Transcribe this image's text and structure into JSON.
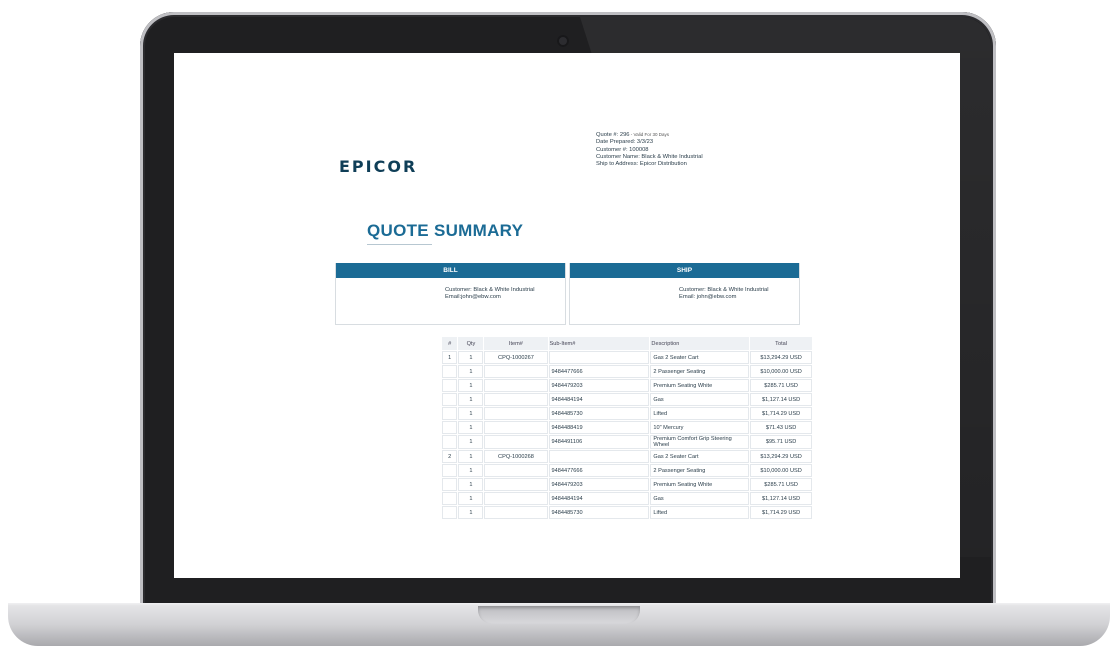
{
  "brand": {
    "logo_text": "EPICOR"
  },
  "meta": {
    "quote_label": "Quote #: 296",
    "valid_note": " - Valid For 30 Days",
    "date_prepared": "Date Prepared: 3/3/23",
    "customer_number": "Customer #: 100008",
    "customer_name": "Customer Name: Black & White Industrial",
    "ship_to": "Ship to Address: Epicor Distribution"
  },
  "title": "QUOTE SUMMARY",
  "bill": {
    "header": "BILL",
    "customer": "Customer: Black & White Industrial",
    "email": "Email:john@ebw.com"
  },
  "ship": {
    "header": "SHIP",
    "customer": "Customer: Black & White Industrial",
    "email": "Email: john@ebw.com"
  },
  "table": {
    "headers": [
      "#",
      "Qty",
      "Item#",
      "Sub-Item#",
      "Description",
      "Total"
    ],
    "rows": [
      [
        "1",
        "1",
        "CPQ-1000267",
        "",
        "Gas 2 Seater Cart",
        "$13,294.29 USD"
      ],
      [
        "",
        "1",
        "",
        "9484477666",
        "2 Passenger Seating",
        "$10,000.00 USD"
      ],
      [
        "",
        "1",
        "",
        "9484479203",
        "Premium Seating White",
        "$285.71 USD"
      ],
      [
        "",
        "1",
        "",
        "9484484194",
        "Gas",
        "$1,127.14 USD"
      ],
      [
        "",
        "1",
        "",
        "9484485730",
        "Lifted",
        "$1,714.29 USD"
      ],
      [
        "",
        "1",
        "",
        "9484488419",
        "10\" Mercury",
        "$71.43 USD"
      ],
      [
        "",
        "1",
        "",
        "9484491106",
        "Premium Comfort Grip Steering Wheel",
        "$95.71 USD"
      ],
      [
        "2",
        "1",
        "CPQ-1000268",
        "",
        "Gas 2 Seater Cart",
        "$13,294.29 USD"
      ],
      [
        "",
        "1",
        "",
        "9484477666",
        "2 Passenger Seating",
        "$10,000.00 USD"
      ],
      [
        "",
        "1",
        "",
        "9484479203",
        "Premium Seating White",
        "$285.71 USD"
      ],
      [
        "",
        "1",
        "",
        "9484484194",
        "Gas",
        "$1,127.14 USD"
      ],
      [
        "",
        "1",
        "",
        "9484485730",
        "Lifted",
        "$1,714.29 USD"
      ]
    ]
  },
  "colors": {
    "accent": "#1b6b95",
    "logo": "#0f3e57"
  }
}
